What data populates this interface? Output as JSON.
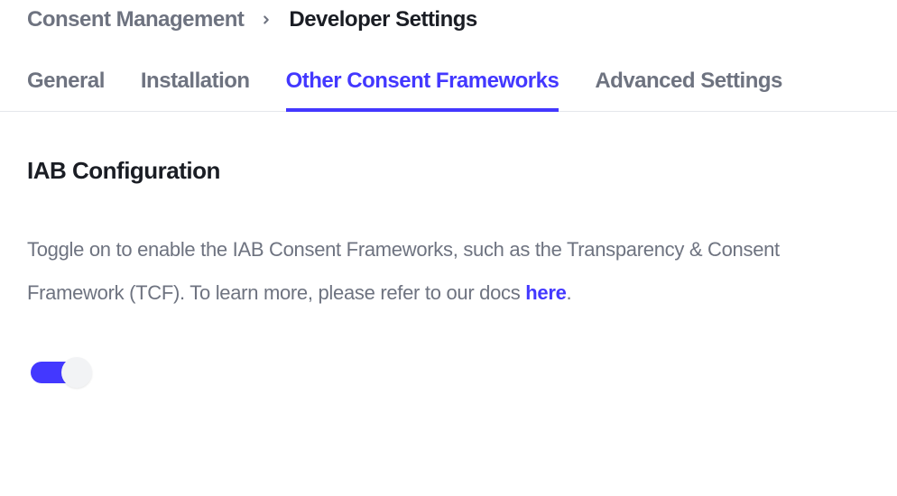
{
  "breadcrumb": {
    "items": [
      "Consent Management",
      "Developer Settings"
    ]
  },
  "tabs": {
    "items": [
      {
        "label": "General",
        "active": false
      },
      {
        "label": "Installation",
        "active": false
      },
      {
        "label": "Other Consent Frameworks",
        "active": true
      },
      {
        "label": "Advanced Settings",
        "active": false
      }
    ]
  },
  "section": {
    "title": "IAB Configuration",
    "desc_part1": "Toggle on to enable the IAB Consent Frameworks, such as the Transparency & Consent Framework (TCF). To learn more, please refer to our docs ",
    "link_text": "here",
    "desc_part2": "."
  },
  "toggle": {
    "on": true
  }
}
